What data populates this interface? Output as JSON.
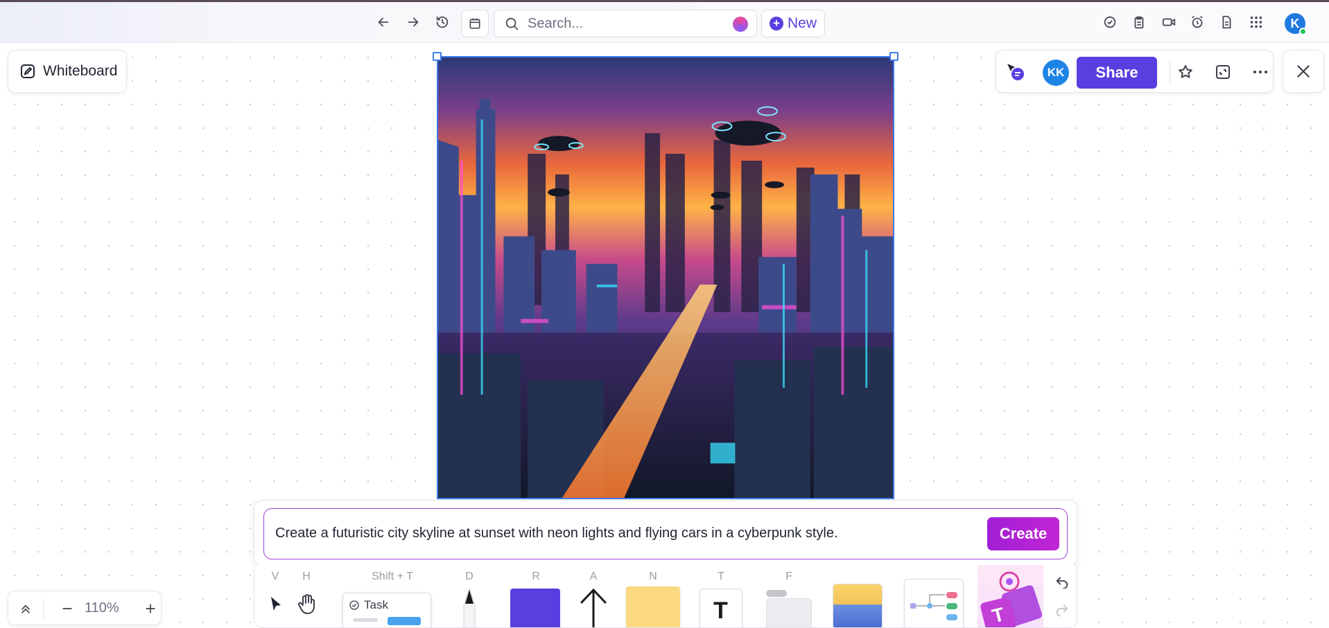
{
  "topbar": {
    "search_placeholder": "Search...",
    "new_label": "New",
    "user_initial": "K"
  },
  "whiteboard": {
    "label": "Whiteboard"
  },
  "right_panel": {
    "collaborator_initials": "KK",
    "share_label": "Share"
  },
  "prompt": {
    "text": "Create a futuristic city skyline at sunset with neon lights and flying cars in a cyberpunk style.",
    "create_label": "Create"
  },
  "toolbar": {
    "keys": {
      "select": "V",
      "hand": "H",
      "task": "Shift + T",
      "draw": "D",
      "rectangle": "R",
      "arrow": "A",
      "note": "N",
      "text": "T",
      "frame": "F"
    },
    "task_label": "Task",
    "text_glyph": "T"
  },
  "zoom": {
    "value": "110%"
  },
  "colors": {
    "accent": "#5b3ee0",
    "selection": "#3a7be8",
    "ai_gradient_start": "#a21fd6",
    "ai_gradient_end": "#c026d3"
  }
}
